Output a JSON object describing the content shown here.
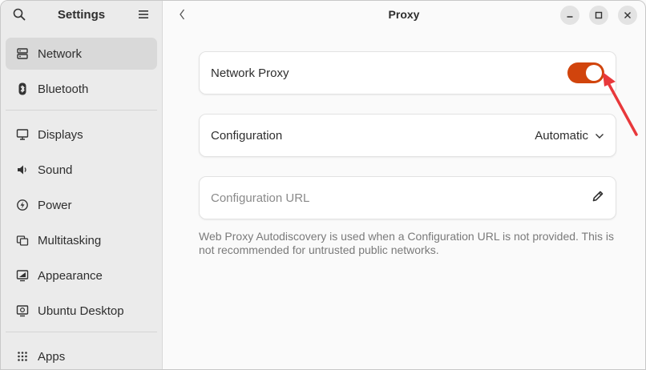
{
  "sidebar": {
    "title": "Settings",
    "items": [
      {
        "label": "Network",
        "icon": "network-icon"
      },
      {
        "label": "Bluetooth",
        "icon": "bluetooth-icon"
      },
      {
        "label": "Displays",
        "icon": "display-icon"
      },
      {
        "label": "Sound",
        "icon": "speaker-icon"
      },
      {
        "label": "Power",
        "icon": "power-icon"
      },
      {
        "label": "Multitasking",
        "icon": "multitasking-icon"
      },
      {
        "label": "Appearance",
        "icon": "appearance-icon"
      },
      {
        "label": "Ubuntu Desktop",
        "icon": "ubuntu-desktop-icon"
      },
      {
        "label": "Apps",
        "icon": "apps-grid-icon"
      }
    ],
    "active_index": 0
  },
  "header": {
    "title": "Proxy"
  },
  "proxy": {
    "network_proxy_label": "Network Proxy",
    "network_proxy_enabled": true,
    "configuration_label": "Configuration",
    "configuration_value": "Automatic",
    "config_url_placeholder": "Configuration URL",
    "hint": "Web Proxy Autodiscovery is used when a Configuration URL is not provided. This is not recommended for untrusted public networks."
  },
  "colors": {
    "accent": "#d1440c",
    "annotation_arrow": "#e8383b"
  }
}
